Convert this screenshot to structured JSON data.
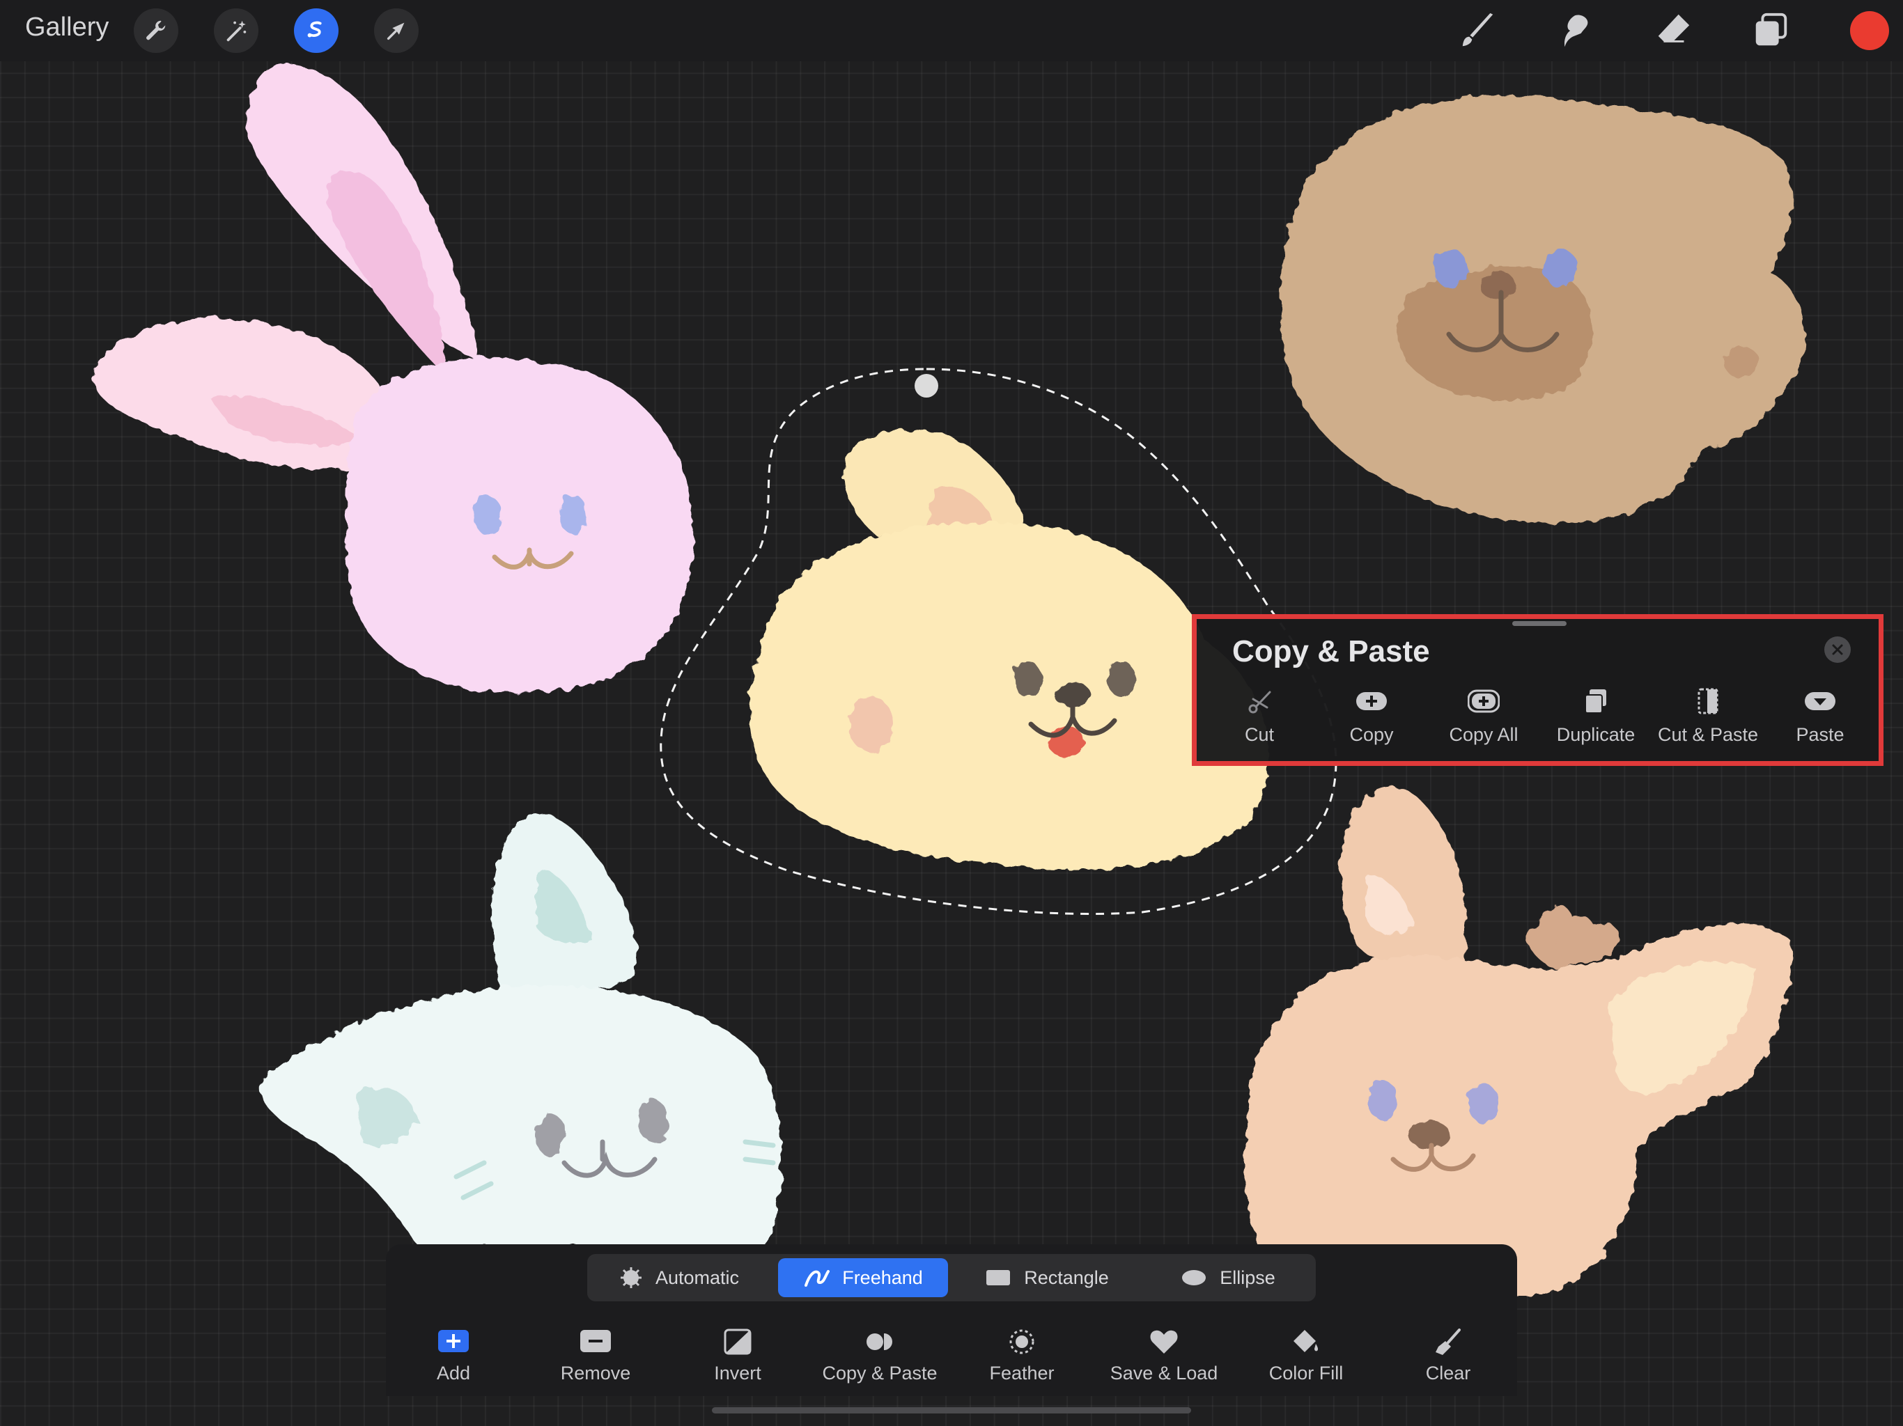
{
  "topbar": {
    "gallery_label": "Gallery",
    "left_tools": [
      "wrench-icon",
      "magic-wand-icon",
      "selection-icon",
      "transform-arrow-icon"
    ],
    "active_tool": "selection-icon",
    "right_tools": [
      "brush-icon",
      "smudge-icon",
      "eraser-icon",
      "layers-icon"
    ],
    "current_color": "#ea3b30"
  },
  "canvas": {
    "characters": [
      "bunny",
      "bear",
      "dog",
      "cat",
      "deer"
    ],
    "selected_character": "dog"
  },
  "copy_paste_panel": {
    "title": "Copy & Paste",
    "close_icon": "close-icon",
    "actions": [
      {
        "label": "Cut",
        "icon": "scissors-icon"
      },
      {
        "label": "Copy",
        "icon": "copy-plus-icon"
      },
      {
        "label": "Copy All",
        "icon": "copy-all-icon"
      },
      {
        "label": "Duplicate",
        "icon": "duplicate-icon"
      },
      {
        "label": "Cut & Paste",
        "icon": "cut-paste-icon"
      },
      {
        "label": "Paste",
        "icon": "paste-icon"
      }
    ],
    "highlight_color": "#e03a3a"
  },
  "selection_toolbar": {
    "modes": [
      {
        "label": "Automatic",
        "icon": "automatic-icon"
      },
      {
        "label": "Freehand",
        "icon": "freehand-icon"
      },
      {
        "label": "Rectangle",
        "icon": "rectangle-icon"
      },
      {
        "label": "Ellipse",
        "icon": "ellipse-icon"
      }
    ],
    "active_mode": "Freehand",
    "tools": [
      {
        "label": "Add",
        "icon": "add-icon"
      },
      {
        "label": "Remove",
        "icon": "remove-icon"
      },
      {
        "label": "Invert",
        "icon": "invert-icon"
      },
      {
        "label": "Copy & Paste",
        "icon": "copy-paste-icon"
      },
      {
        "label": "Feather",
        "icon": "feather-icon"
      },
      {
        "label": "Save & Load",
        "icon": "save-load-icon"
      },
      {
        "label": "Color Fill",
        "icon": "color-fill-icon"
      },
      {
        "label": "Clear",
        "icon": "clear-icon"
      }
    ]
  },
  "colors": {
    "accent": "#2f6df2",
    "background": "#1f1f20",
    "panel": "#1c1c1e"
  }
}
